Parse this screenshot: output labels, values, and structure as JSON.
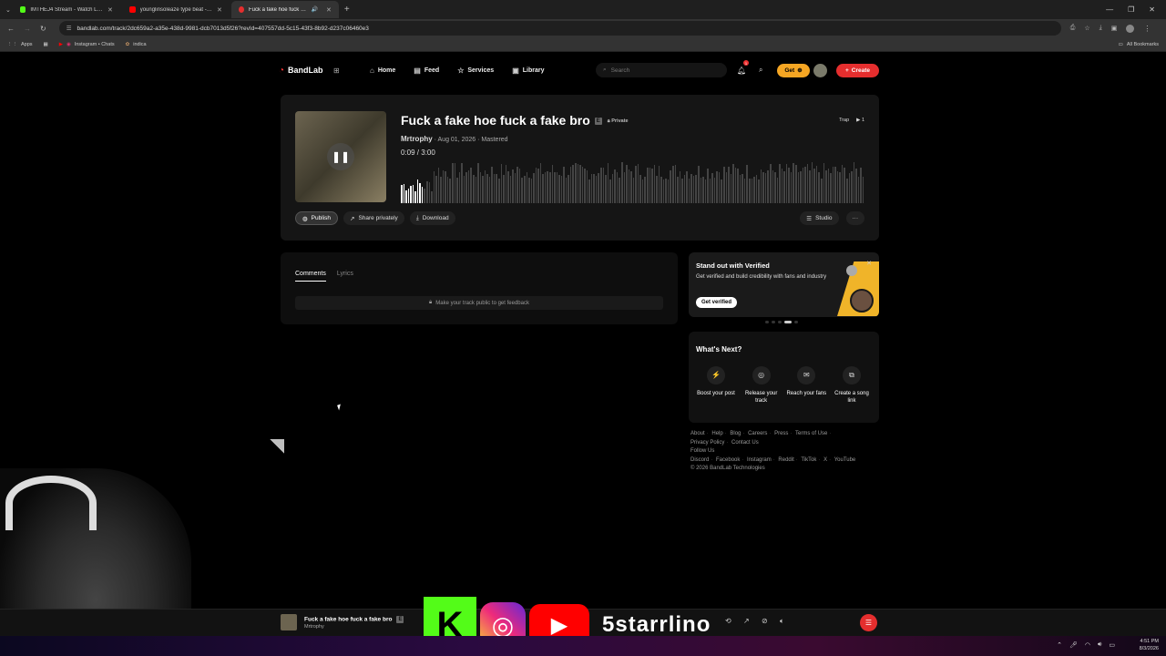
{
  "browser": {
    "tabs": [
      {
        "title": "IMTHEJ4 Stream - Watch Live o",
        "color": "#53fc18"
      },
      {
        "title": "younglinsoleaze type beat - Yo",
        "color": "#ff0000"
      },
      {
        "title": "Fuck a fake hoe fuck a fake",
        "color": "#e52e2e"
      }
    ],
    "url": "bandlab.com/track/2dc659a2-a35e-438d-9981-dcb7013d5f26?revId=407557dd-5c15-43f3-8b92-d237c06460e3",
    "bookmarks": [
      "Apps",
      "Instagram • Chats",
      "indica"
    ],
    "all_bookmarks": "All Bookmarks"
  },
  "nav": {
    "logo": "BandLab",
    "links": [
      "Home",
      "Feed",
      "Services",
      "Library"
    ],
    "search_placeholder": "Search",
    "notification_count": "1",
    "get_label": "Get",
    "create_label": "Create"
  },
  "track": {
    "title": "Fuck a fake hoe fuck a fake bro",
    "explicit": "E",
    "visibility": "Private",
    "genre": "Trap",
    "play_count": "1",
    "artist": "Mrtrophy",
    "date_status": "· Aug 01, 2026 · Mastered",
    "time_current": "0:09",
    "time_total": "3:00",
    "progress": 0.05,
    "actions": [
      "Publish",
      "Share privately",
      "Download"
    ],
    "studio_label": "Studio",
    "more_label": "···"
  },
  "comments": {
    "tabs": [
      "Comments",
      "Lyrics"
    ],
    "notice": "Make your track public to get feedback"
  },
  "promo": {
    "title": "Stand out with Verified",
    "text": "Get verified and build credibility with fans and industry",
    "button": "Get verified"
  },
  "whats_next": {
    "title": "What's Next?",
    "items": [
      {
        "label": "Boost your post",
        "icon": "bolt-icon",
        "glyph": "⚡"
      },
      {
        "label": "Release your track",
        "icon": "release-icon",
        "glyph": "◎"
      },
      {
        "label": "Reach your fans",
        "icon": "mail-icon",
        "glyph": "✉"
      },
      {
        "label": "Create a song link",
        "icon": "link-icon",
        "glyph": "⧉"
      }
    ]
  },
  "footer": {
    "links": [
      "About",
      "Help",
      "Blog",
      "Careers",
      "Press",
      "Terms of Use",
      "Privacy Policy",
      "Contact Us"
    ],
    "follow_label": "Follow Us",
    "social": [
      "Discord",
      "Facebook",
      "Instagram",
      "Reddit",
      "TikTok",
      "X",
      "YouTube"
    ],
    "copyright": "© 2026 BandLab Technologies"
  },
  "player": {
    "title": "Fuck a fake hoe fuck a fake bro",
    "explicit": "E",
    "artist": "Mrtrophy"
  },
  "overlay": {
    "kick_letter": "K",
    "handle": "5starrlino"
  },
  "taskbar": {
    "time": "4:51 PM",
    "date": "8/3/2026"
  },
  "colors": {
    "accent": "#e52e2e",
    "get_button": "#f5a623",
    "kick_green": "#53fc18"
  }
}
